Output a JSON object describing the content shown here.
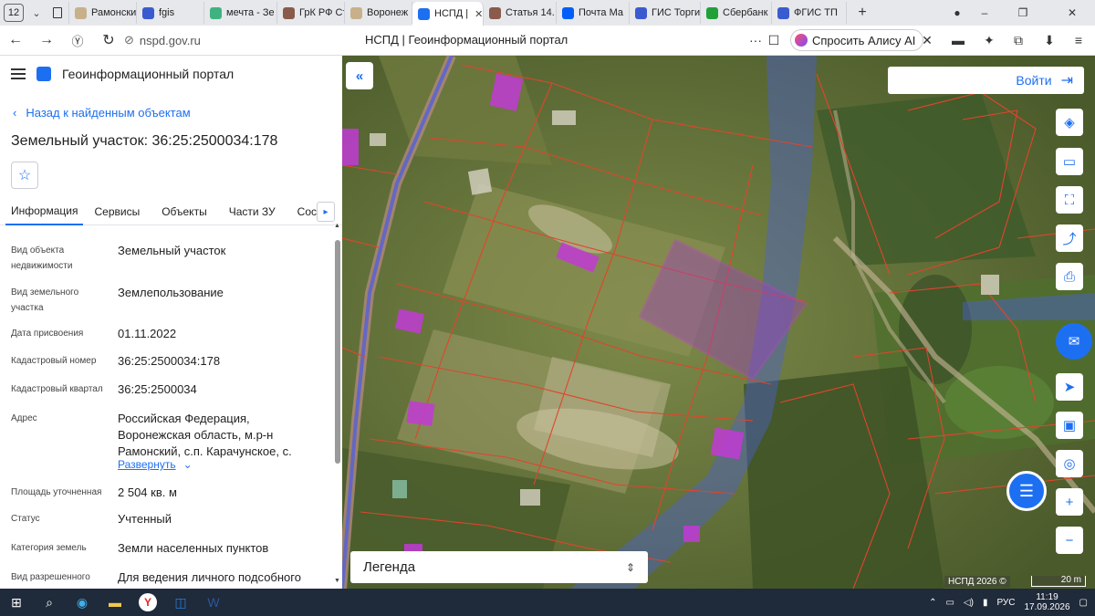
{
  "browser": {
    "tab_count": "12",
    "tabs": [
      {
        "label": "Рамонски",
        "color": "#c8b08a"
      },
      {
        "label": "fgis",
        "color": "#3a5bd0"
      },
      {
        "label": "мечта - Зе",
        "color": "#3fb37f"
      },
      {
        "label": "ГрК РФ Ст",
        "color": "#8a5a4a"
      },
      {
        "label": "Воронеж",
        "color": "#c8b08a"
      },
      {
        "label": "НСПД |",
        "color": "#1d6ff2",
        "active": true
      },
      {
        "label": "Статья 14.",
        "color": "#8a5a4a"
      },
      {
        "label": "Почта Ма",
        "color": "#005ff9"
      },
      {
        "label": "ГИС Торги",
        "color": "#3a5bd0"
      },
      {
        "label": "Сбербанк",
        "color": "#21a038"
      },
      {
        "label": "ФГИС ТП",
        "color": "#3a5bd0"
      }
    ],
    "url": "nspd.gov.ru",
    "page_title": "НСПД | Геоинформационный портал",
    "alisa_label": "Спросить Алису AI"
  },
  "sidebar": {
    "portal_name": "Геоинформационный портал",
    "back_label": "Назад к найденным объектам",
    "object_title": "Земельный участок: 36:25:2500034:178",
    "tabs": [
      "Информация",
      "Сервисы",
      "Объекты",
      "Части ЗУ",
      "Состав"
    ],
    "rows": [
      {
        "key": "Вид объекта недвижимости",
        "value": "Земельный участок"
      },
      {
        "key": "Вид земельного участка",
        "value": "Землепользование"
      },
      {
        "key": "Дата присвоения",
        "value": "01.11.2022"
      },
      {
        "key": "Кадастровый номер",
        "value": "36:25:2500034:178"
      },
      {
        "key": "Кадастровый квартал",
        "value": "36:25:2500034"
      },
      {
        "key": "Адрес",
        "value": "Российская Федерация, Воронежская область, м.р-н Рамонский, с.п. Карачунское, с."
      },
      {
        "key": "Площадь уточненная",
        "value": "2 504 кв. м"
      },
      {
        "key": "Статус",
        "value": "Учтенный"
      },
      {
        "key": "Категория земель",
        "value": "Земли населенных пунктов"
      },
      {
        "key": "Вид разрешенного",
        "value": "Для ведения личного подсобного"
      }
    ],
    "expand_label": "Развернуть"
  },
  "map": {
    "login_label": "Войти",
    "legend_label": "Легенда",
    "copyright": "НСПД 2026 ©",
    "scale_label": "20 m",
    "colors": {
      "parcel_border": "#e0452c",
      "selected_fill": "#a23cc8",
      "zone_fill": "#4a5fd8",
      "buildings": "#c23ad6"
    }
  },
  "taskbar": {
    "lang": "РУС",
    "time": "11:19",
    "date": "17.09.2026"
  }
}
